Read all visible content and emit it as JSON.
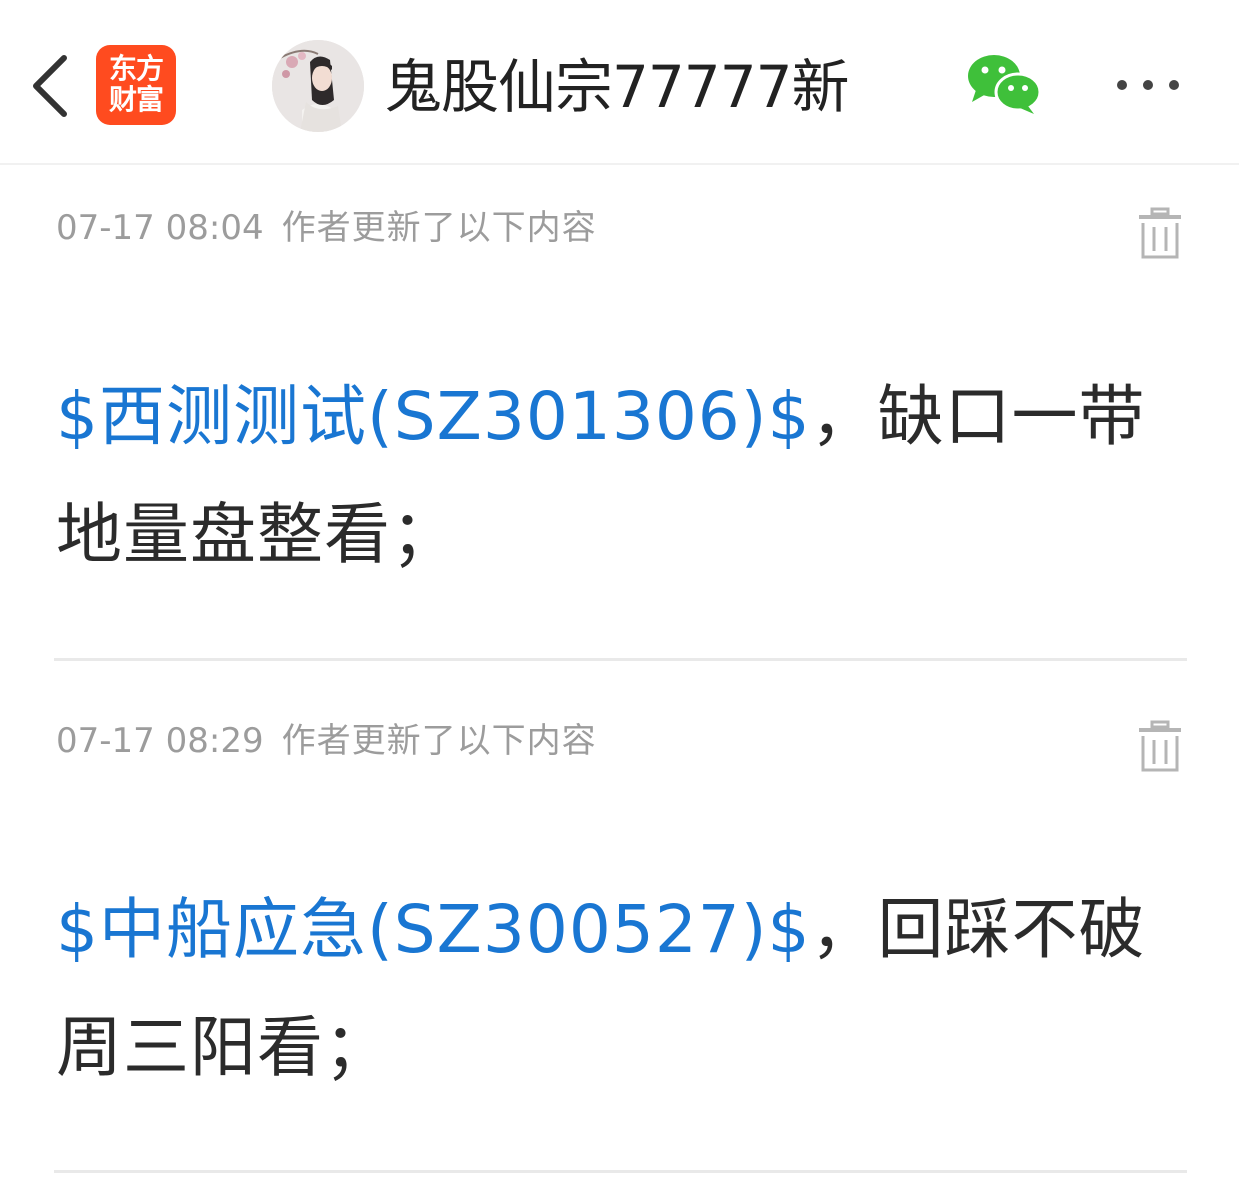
{
  "header": {
    "app_logo_line1": "东方",
    "app_logo_line2": "财富",
    "author_name": "鬼股仙宗77777新",
    "back_icon": "chevron-left-icon",
    "share_icon": "wechat-icon",
    "more_icon": "more-dots-icon"
  },
  "updates": [
    {
      "time": "07-17 08:04",
      "note": "作者更新了以下内容",
      "stock_link": "$西测测试(SZ301306)$",
      "text": "，缺口一带地量盘整看；"
    },
    {
      "time": "07-17 08:29",
      "note": "作者更新了以下内容",
      "stock_link": "$中船应急(SZ300527)$",
      "text": "，回踩不破周三阳看；"
    }
  ],
  "colors": {
    "link": "#1976d2",
    "body_text": "#2b2b2b",
    "meta_text": "#9c9c9c",
    "logo_bg": "#ff4b1f",
    "wechat_green": "#3fc03a"
  }
}
